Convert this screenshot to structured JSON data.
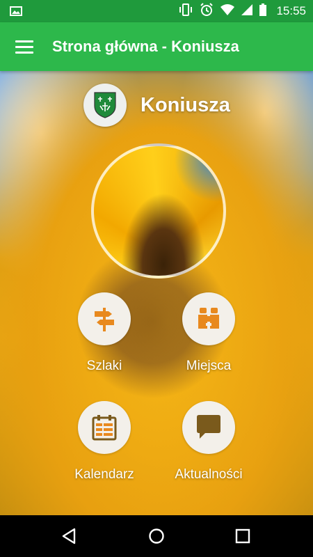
{
  "status_bar": {
    "time": "15:55",
    "icons": [
      "image-icon",
      "vibrate-icon",
      "alarm-icon",
      "wifi-icon",
      "signal-icon",
      "battery-icon"
    ]
  },
  "app_bar": {
    "title": "Strona główna - Koniusza",
    "menu_icon": "hamburger-menu-icon"
  },
  "header": {
    "name": "Koniusza",
    "logo": "coat-of-arms-icon"
  },
  "menu": {
    "items": [
      {
        "label": "Szlaki",
        "icon": "signpost-icon"
      },
      {
        "label": "Miejsca",
        "icon": "binoculars-icon"
      },
      {
        "label": "Kalendarz",
        "icon": "calendar-icon"
      },
      {
        "label": "Aktualności",
        "icon": "chat-bubble-icon"
      }
    ]
  },
  "nav_bar": {
    "icons": [
      "back-icon",
      "home-icon",
      "recents-icon"
    ]
  },
  "colors": {
    "app_bar": "#2db84b",
    "status_bar": "#1f9a3c",
    "icon_accent": "#e8891e",
    "button_bg": "#f3f0ea"
  }
}
